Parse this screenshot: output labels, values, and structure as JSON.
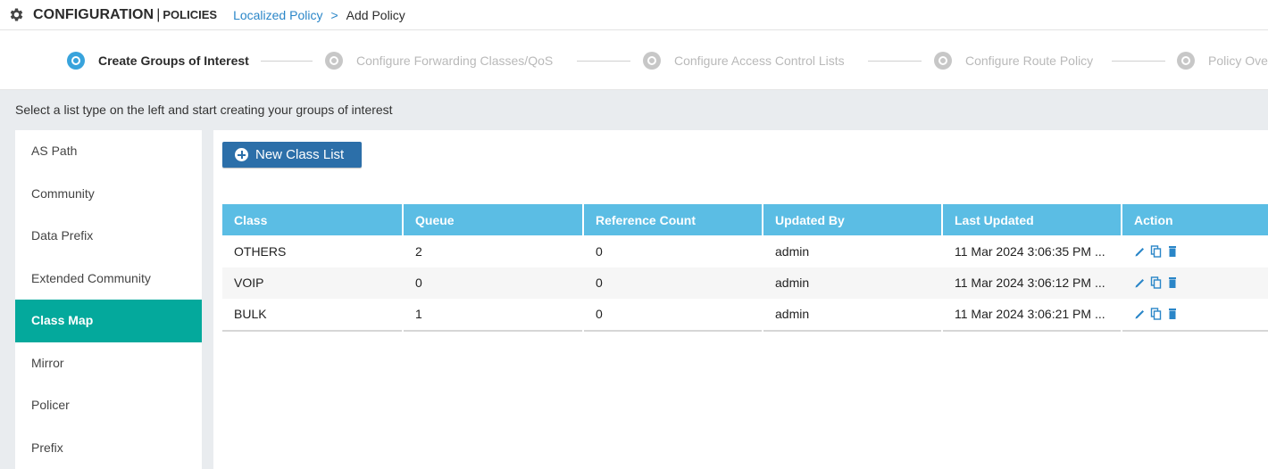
{
  "header": {
    "title": "CONFIGURATION",
    "separator": "|",
    "subtitle": "POLICIES",
    "breadcrumb_link": "Localized Policy",
    "breadcrumb_arrow": ">",
    "breadcrumb_current": "Add Policy"
  },
  "wizard": {
    "steps": [
      {
        "label": "Create Groups of Interest",
        "active": true
      },
      {
        "label": "Configure Forwarding Classes/QoS",
        "active": false
      },
      {
        "label": "Configure Access Control Lists",
        "active": false
      },
      {
        "label": "Configure Route Policy",
        "active": false
      },
      {
        "label": "Policy Ove",
        "active": false
      }
    ]
  },
  "hint": "Select a list type on the left and start creating your groups of interest",
  "sidebar": {
    "items": [
      {
        "label": "AS Path"
      },
      {
        "label": "Community"
      },
      {
        "label": "Data Prefix"
      },
      {
        "label": "Extended Community"
      },
      {
        "label": "Class Map"
      },
      {
        "label": "Mirror"
      },
      {
        "label": "Policer"
      },
      {
        "label": "Prefix"
      }
    ],
    "active_index": 4
  },
  "toolbar": {
    "new_button_label": "New Class List"
  },
  "table": {
    "columns": [
      "Class",
      "Queue",
      "Reference Count",
      "Updated By",
      "Last Updated",
      "Action"
    ],
    "rows": [
      {
        "class": "OTHERS",
        "queue": "2",
        "reference_count": "0",
        "updated_by": "admin",
        "last_updated": "11 Mar 2024 3:06:35 PM ..."
      },
      {
        "class": "VOIP",
        "queue": "0",
        "reference_count": "0",
        "updated_by": "admin",
        "last_updated": "11 Mar 2024 3:06:12 PM ..."
      },
      {
        "class": "BULK",
        "queue": "1",
        "reference_count": "0",
        "updated_by": "admin",
        "last_updated": "11 Mar 2024 3:06:21 PM ..."
      }
    ],
    "action_icons": [
      "edit-icon",
      "copy-icon",
      "delete-icon"
    ]
  },
  "colors": {
    "accent_blue": "#2c6fa9",
    "link_blue": "#2a86c8",
    "table_header": "#5bbde4",
    "active_teal": "#04a99c",
    "step_active": "#38a3dc"
  }
}
